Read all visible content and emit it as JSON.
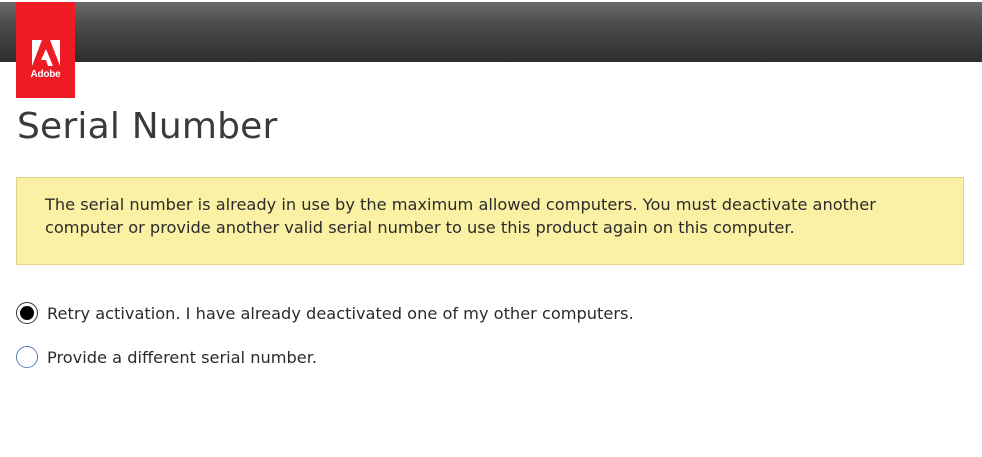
{
  "header": {
    "logo_text": "Adobe",
    "brand_color": "#ed1c24"
  },
  "page": {
    "title": "Serial Number"
  },
  "alert": {
    "message": "The serial number is already in use by the maximum allowed computers. You must deactivate another computer or provide another valid serial number to use this product again on this computer.",
    "background_color": "#fbf1a5"
  },
  "options": [
    {
      "label": "Retry activation. I have already deactivated one of my other computers.",
      "selected": true
    },
    {
      "label": "Provide a different serial number.",
      "selected": false
    }
  ]
}
